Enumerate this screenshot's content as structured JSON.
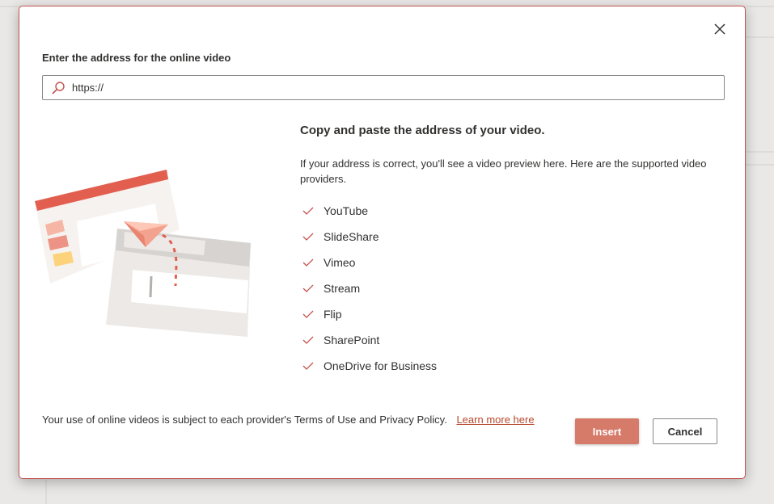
{
  "dialog": {
    "prompt": "Enter the address for the online video",
    "url_input": {
      "value": "https://",
      "placeholder": ""
    },
    "info": {
      "title": "Copy and paste the address of your video.",
      "description": "If your address is correct, you'll see a video preview here. Here are the supported video providers.",
      "providers": [
        "YouTube",
        "SlideShare",
        "Vimeo",
        "Stream",
        "Flip",
        "SharePoint",
        "OneDrive for Business"
      ]
    },
    "terms_text": "Your use of online videos is subject to each provider's Terms of Use and Privacy Policy.",
    "learn_more_link": "Learn more here",
    "insert_label": "Insert",
    "cancel_label": "Cancel"
  },
  "icons": {
    "close": "close-icon",
    "search": "search-icon",
    "check": "check-icon",
    "illustration": "paper-plane-slides-illustration"
  },
  "colors": {
    "accent": "#c4524d",
    "insert_button": "#d67a6a",
    "link": "#b7472a",
    "check": "#c4524d"
  }
}
